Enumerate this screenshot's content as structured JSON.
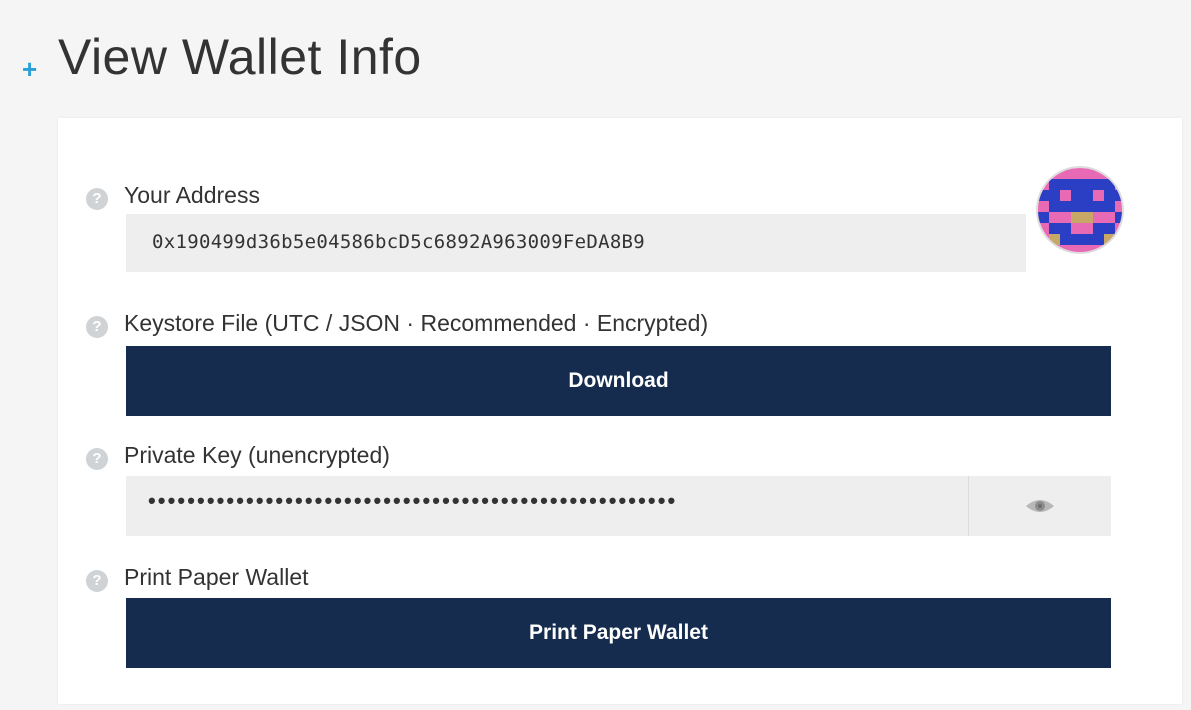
{
  "header": {
    "expand_symbol": "+",
    "title": "View Wallet Info"
  },
  "address": {
    "label": "Your Address",
    "value": "0x190499d36b5e04586bcD5c6892A963009FeDA8B9"
  },
  "keystore": {
    "label": "Keystore File (UTC / JSON · Recommended · Encrypted)",
    "button_label": "Download"
  },
  "private_key": {
    "label": "Private Key (unencrypted)",
    "masked_value": "••••••••••••••••••••••••••••••••••••••••••••••••••••••",
    "toggle_icon": "eye-icon"
  },
  "paper_wallet": {
    "label": "Print Paper Wallet",
    "button_label": "Print Paper Wallet"
  },
  "help_symbol": "?",
  "colors": {
    "accent": "#2a9fd8",
    "button_bg": "#152c4f",
    "field_bg": "#eeeeee",
    "help_icon": "#cfd3d6",
    "identicon_pink": "#e86ab4",
    "identicon_blue": "#2a3fc4",
    "identicon_tan": "#c7a866"
  }
}
